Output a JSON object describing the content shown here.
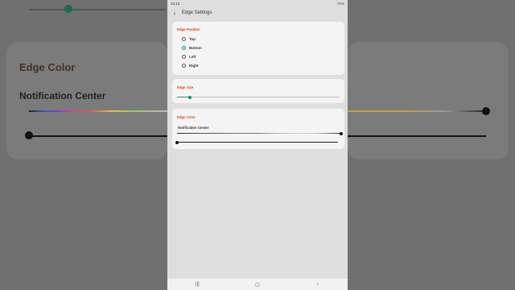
{
  "background": {
    "edge_color_title": "Edge Color",
    "notification_center": "Notification Center"
  },
  "status_bar": {
    "time": "10:13",
    "battery": "71%"
  },
  "app_bar": {
    "back_icon": "chevron-left-icon",
    "title": "Edge Settings"
  },
  "edge_position": {
    "title": "Edge Position",
    "options": [
      {
        "label": "Top",
        "selected": false
      },
      {
        "label": "Bottom",
        "selected": true
      },
      {
        "label": "Left",
        "selected": false
      },
      {
        "label": "Right",
        "selected": false
      }
    ]
  },
  "edge_size": {
    "title": "Edge Size",
    "value_fraction": 0.08
  },
  "edge_color": {
    "title": "Edge Color",
    "notification_center_label": "Notification Center",
    "hue_slider_fraction": 1.0,
    "brightness_slider_fraction": 0.0
  },
  "navigation_bar": {
    "recent_icon": "recent-apps-icon",
    "home_icon": "home-icon",
    "back_icon": "back-icon"
  },
  "colors": {
    "accent": "#1a8f5a",
    "section_title": "#d84a1b"
  }
}
